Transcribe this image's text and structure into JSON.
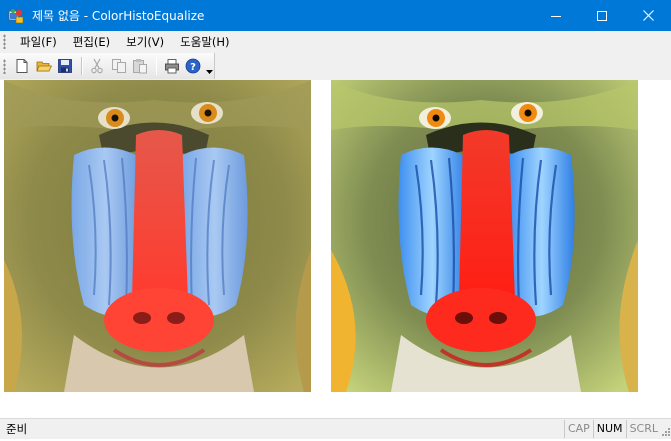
{
  "window": {
    "title": "제목 없음 - ColorHistoEqualize",
    "accent": "#0078d7"
  },
  "menu": {
    "items": [
      {
        "label": "파일(F)"
      },
      {
        "label": "편집(E)"
      },
      {
        "label": "보기(V)"
      },
      {
        "label": "도움말(H)"
      }
    ]
  },
  "toolbar": {
    "buttons": [
      "new-file-icon",
      "open-folder-icon",
      "save-disk-icon",
      "cut-icon",
      "copy-icon",
      "paste-icon",
      "print-icon",
      "help-icon"
    ]
  },
  "images": {
    "left": {
      "name": "original-mandrill-image"
    },
    "right": {
      "name": "equalized-mandrill-image"
    }
  },
  "status": {
    "text": "준비",
    "cap": "CAP",
    "num": "NUM",
    "scrl": "SCRL"
  }
}
